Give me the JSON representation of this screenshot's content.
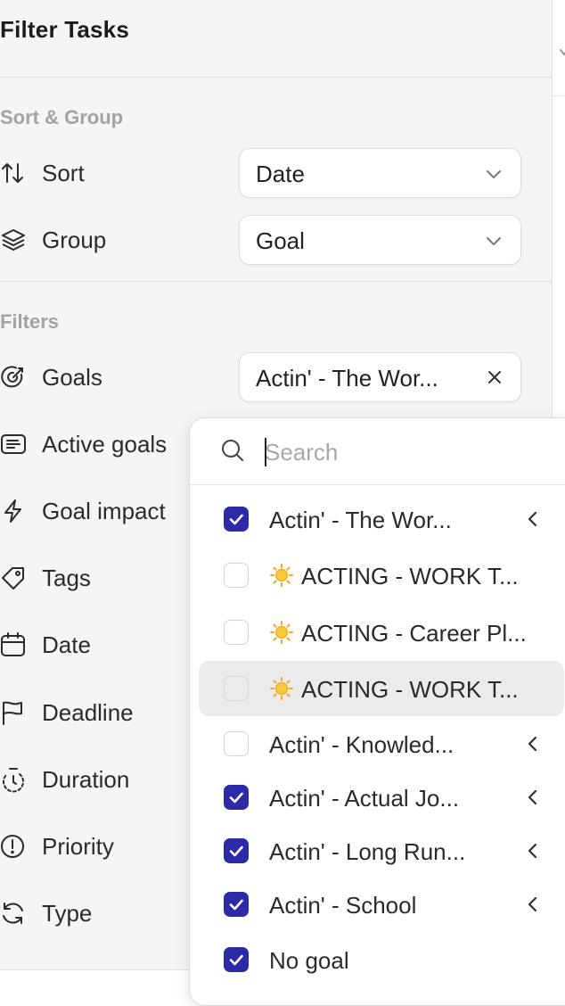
{
  "title": "Filter Tasks",
  "sort_group": {
    "section_label": "Sort & Group",
    "sort": {
      "label": "Sort",
      "value": "Date"
    },
    "group": {
      "label": "Group",
      "value": "Goal"
    }
  },
  "filters": {
    "section_label": "Filters",
    "goals": {
      "label": "Goals",
      "value": "Actin' - The Wor..."
    },
    "items": [
      {
        "label": "Active goals"
      },
      {
        "label": "Goal impact"
      },
      {
        "label": "Tags"
      },
      {
        "label": "Date"
      },
      {
        "label": "Deadline"
      },
      {
        "label": "Duration"
      },
      {
        "label": "Priority"
      },
      {
        "label": "Type"
      }
    ]
  },
  "dropdown": {
    "search_placeholder": "Search",
    "options": [
      {
        "label": "Actin' - The Wor...",
        "checked": true,
        "expandable": true
      },
      {
        "label": "ACTING - WORK T...",
        "checked": false,
        "sun": true
      },
      {
        "label": "ACTING - Career Pl...",
        "checked": false,
        "sun": true
      },
      {
        "label": "ACTING - WORK T...",
        "checked": false,
        "sun": true,
        "highlighted": true
      },
      {
        "label": "Actin' - Knowled...",
        "checked": false,
        "expandable": true
      },
      {
        "label": "Actin' - Actual Jo...",
        "checked": true,
        "expandable": true
      },
      {
        "label": "Actin' - Long Run...",
        "checked": true,
        "expandable": true
      },
      {
        "label": "Actin' - School",
        "checked": true,
        "expandable": true
      },
      {
        "label": "No goal",
        "checked": true
      }
    ]
  },
  "colors": {
    "checkbox_checked": "#2c2aa6",
    "panel_bg": "#f5f5f5",
    "section_label": "#a3a3a3"
  }
}
